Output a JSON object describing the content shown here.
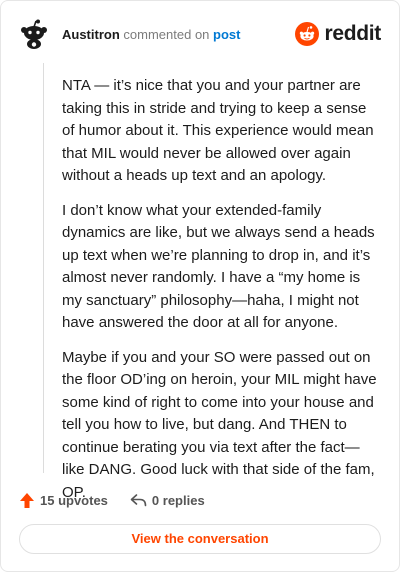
{
  "header": {
    "username": "Austitron",
    "action_text": "commented on",
    "post_link": "post",
    "brand": "reddit",
    "avatar_icon": "snoo-avatar-icon",
    "brand_icon": "reddit-logo-icon",
    "brand_color": "#ff4500"
  },
  "comment": {
    "paragraphs": [
      "NTA — it’s nice that you and your partner are taking this in stride and trying to keep a sense of humor about it. This experience would mean that MIL would never be allowed over again without a heads up text and an apology.",
      "I don’t know what your extended-family dynamics are like, but we always send a heads up text when we’re planning to drop in, and it’s almost never randomly. I have a “my home is my sanctuary” philosophy—haha, I might not have answered the door at all for anyone.",
      "Maybe if you and your SO were passed out on the floor OD’ing on heroin, your MIL might have some kind of right to come into your house and tell you how to live, but dang. And THEN to continue berating you via text after the fact—like DANG. Good luck with that side of the fam, OP."
    ]
  },
  "actions": {
    "upvotes": "15 upvotes",
    "replies": "0 replies",
    "upvote_icon": "upvote-arrow-icon",
    "reply_icon": "reply-arrow-icon",
    "upvote_color": "#ff4500"
  },
  "footer": {
    "view_button": "View the conversation"
  }
}
